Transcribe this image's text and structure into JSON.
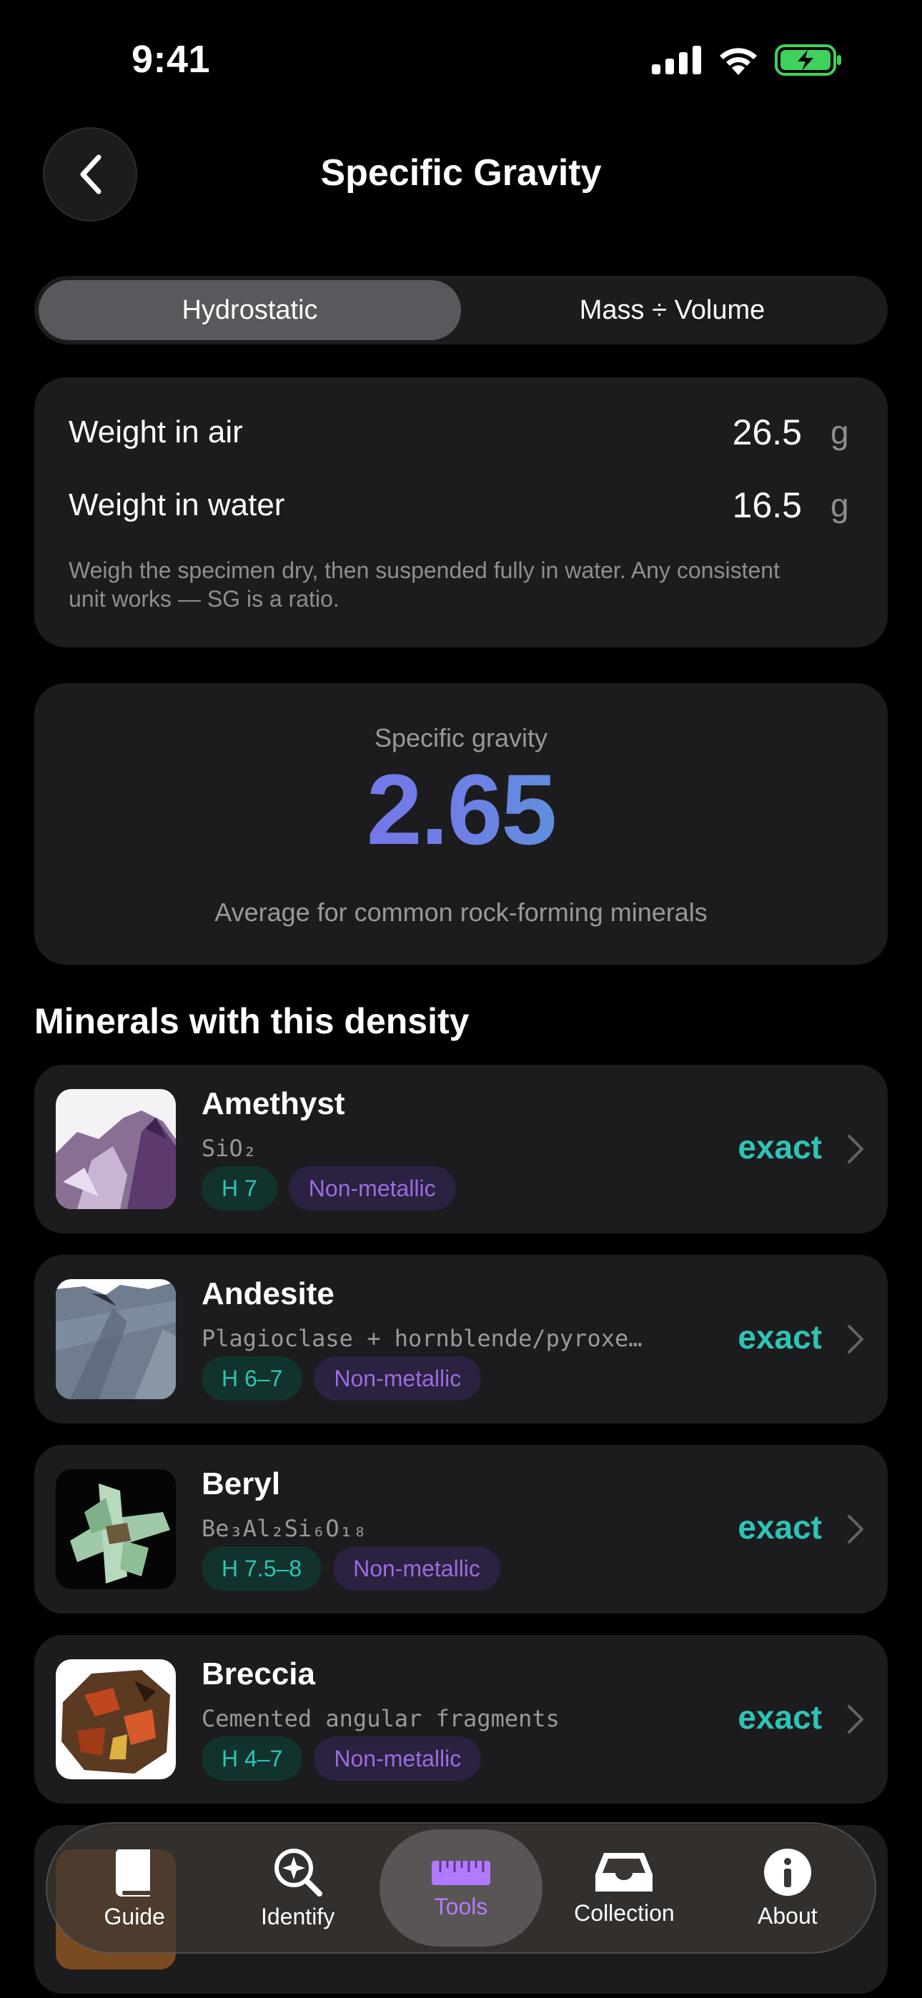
{
  "status_bar": {
    "time": "9:41"
  },
  "header": {
    "title": "Specific Gravity"
  },
  "segments": [
    {
      "label": "Hydrostatic",
      "active": true
    },
    {
      "label": "Mass ÷ Volume",
      "active": false
    }
  ],
  "inputs": {
    "weight_air": {
      "label": "Weight in air",
      "value": "26.5",
      "unit": "g"
    },
    "weight_water": {
      "label": "Weight in water",
      "value": "16.5",
      "unit": "g"
    },
    "hint": "Weigh the specimen dry, then suspended fully in water. Any consistent unit works — SG is a ratio."
  },
  "result": {
    "label": "Specific gravity",
    "value": "2.65",
    "description": "Average for common rock-forming minerals"
  },
  "section_title": "Minerals with this density",
  "minerals": [
    {
      "name": "Amethyst",
      "formula": "SiO₂",
      "hardness": "H 7",
      "luster": "Non-metallic",
      "match": "exact"
    },
    {
      "name": "Andesite",
      "formula": "Plagioclase + hornblende/pyroxe…",
      "hardness": "H 6–7",
      "luster": "Non-metallic",
      "match": "exact"
    },
    {
      "name": "Beryl",
      "formula": "Be₃Al₂Si₆O₁₈",
      "hardness": "H 7.5–8",
      "luster": "Non-metallic",
      "match": "exact"
    },
    {
      "name": "Breccia",
      "formula": "Cemented angular fragments",
      "hardness": "H 4–7",
      "luster": "Non-metallic",
      "match": "exact"
    }
  ],
  "tabs": [
    {
      "label": "Guide",
      "icon": "book-icon"
    },
    {
      "label": "Identify",
      "icon": "magnify-sparkle-icon"
    },
    {
      "label": "Tools",
      "icon": "ruler-icon",
      "active": true
    },
    {
      "label": "Collection",
      "icon": "tray-icon"
    },
    {
      "label": "About",
      "icon": "info-icon"
    }
  ],
  "colors": {
    "accent_teal": "#2ec4b6",
    "accent_purple": "#9b6dde",
    "active_tab": "#b27bff"
  }
}
